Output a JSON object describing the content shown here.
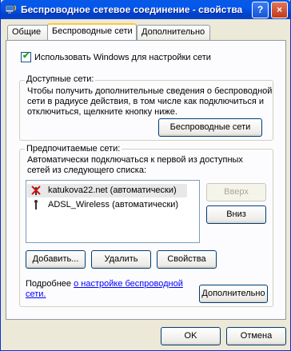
{
  "window": {
    "title": "Беспроводное сетевое соединение - свойства",
    "help": "?",
    "close": "×"
  },
  "tabs": [
    {
      "label": "Общие"
    },
    {
      "label": "Беспроводные сети"
    },
    {
      "label": "Дополнительно"
    }
  ],
  "use_windows": {
    "label": "Использовать Windows для настройки сети",
    "checked": true,
    "mark": "✔"
  },
  "available": {
    "title": "Доступные сети:",
    "text": [
      "Чтобы получить дополнительные сведения о беспроводной",
      "сети в радиусе действия, в том числе как подключиться и",
      "отключиться, щелкните кнопку ниже."
    ],
    "button": "Беспроводные сети"
  },
  "preferred": {
    "title": "Предпочитаемые сети:",
    "text": [
      "Автоматически подключаться к первой из доступных",
      "сетей из следующего списка:"
    ],
    "networks": [
      {
        "name": "katukova22.net (автоматически)",
        "icon": "network-disconnected-icon"
      },
      {
        "name": "ADSL_Wireless (автоматически)",
        "icon": "network-antenna-icon"
      }
    ],
    "up": "Вверх",
    "down": "Вниз",
    "add": "Добавить...",
    "remove": "Удалить",
    "properties": "Свойства",
    "learn_prefix": "Подробнее ",
    "learn_link_1": "о настройке  беспроводной",
    "learn_link_2": "сети.",
    "advanced": "Дополнительно"
  },
  "footer": {
    "ok": "OK",
    "cancel": "Отмена"
  }
}
